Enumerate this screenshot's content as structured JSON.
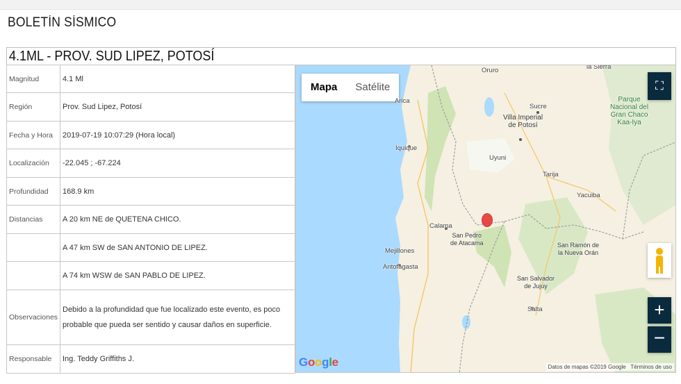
{
  "page": {
    "title": "BOLETÍN SÍSMICO"
  },
  "event": {
    "title": "4.1ML - PROV. SUD LIPEZ, POTOSÍ"
  },
  "rows": [
    {
      "label": "Magnitud",
      "value": "4.1 Ml"
    },
    {
      "label": "Región",
      "value": "Prov. Sud Lipez, Potosí"
    },
    {
      "label": "Fecha y Hora",
      "value": "2019-07-19 10:07:29 (Hora local)"
    },
    {
      "label": "Localización",
      "value": "-22.045 ; -67.224"
    },
    {
      "label": "Profundidad",
      "value": "168.9 km"
    },
    {
      "label": "Distancias",
      "value": "A 20 km NE de QUETENA CHICO."
    },
    {
      "label": "",
      "value": "A 47 km SW de SAN ANTONIO DE LIPEZ."
    },
    {
      "label": "",
      "value": "A 74 km WSW de SAN PABLO DE LIPEZ."
    },
    {
      "label": "Observaciones",
      "value": "Debido a la profundidad que fue localizado este evento, es poco probable que pueda ser sentido y causar daños en superficie."
    },
    {
      "label": "Responsable",
      "value": "Ing. Teddy Griffiths J."
    }
  ],
  "map": {
    "type_buttons": {
      "map": "Mapa",
      "satellite": "Satélite"
    },
    "zoom_in": "+",
    "zoom_out": "−",
    "fullscreen_icon": "fullscreen-icon",
    "logo": "Google",
    "attribution": "Datos de mapas ©2019 Google",
    "terms": "Términos de uso",
    "marker_color": "#e53935",
    "labels": {
      "oruro": "Oruro",
      "arica": "Arica",
      "sucre": "Sucre",
      "villa_imperial": "Villa Imperial\nde Potosí",
      "iquique": "Iquique",
      "uyuni": "Uyuni",
      "park": "Parque\nNacional del\nGran Chaco\nKaa-Iya",
      "tarija": "Tarija",
      "yacuiba": "Yacuiba",
      "calama": "Calama",
      "san_pedro": "San Pedro\nde Atacama",
      "mejillones": "Mejillones",
      "antofagasta": "Antofagasta",
      "san_ramon": "San Ramón de\nla Nueva Orán",
      "san_salvador": "San Salvador\nde Jujuy",
      "salta": "Salta",
      "la_sierra": "la Sierra"
    }
  }
}
